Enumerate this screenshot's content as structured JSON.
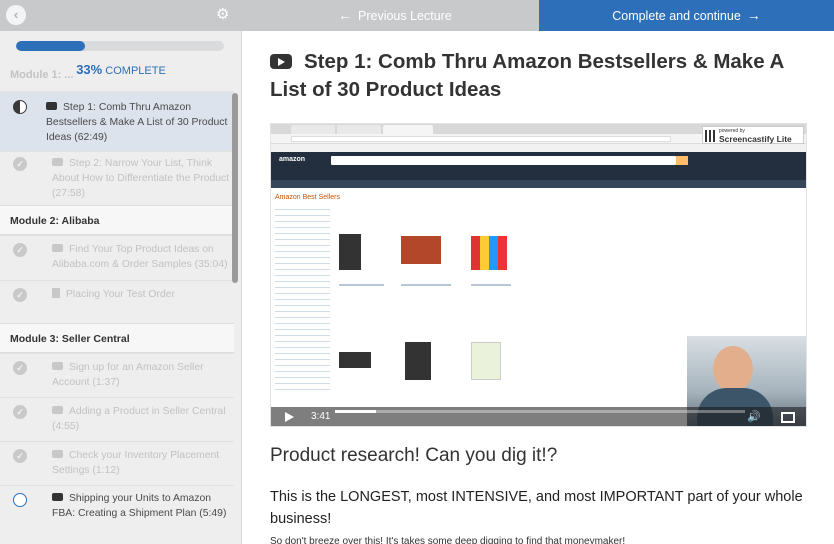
{
  "topbar": {
    "prev_label": "Previous Lecture",
    "complete_label": "Complete and continue",
    "prev_arrow": "←",
    "complete_arrow": "→",
    "back_icon": "‹",
    "gear_icon": "⚙"
  },
  "progress": {
    "percent": 33,
    "percent_label": "33%",
    "label": "COMPLETE",
    "fill_color": "#2d6fb8"
  },
  "sidebar": {
    "ghost_module": "Module 1: ...",
    "modules": [
      {
        "title": "Module 2: Alibaba"
      },
      {
        "title": "Module 3: Seller Central"
      }
    ],
    "items": [
      {
        "label": "Step 1: Comb Thru Amazon Bestsellers & Make A List of 30 Product Ideas (62:49)",
        "status": "half",
        "type": "video"
      },
      {
        "label": "Step 2: Narrow Your List, Think About How to Differentiate the Product (27:58)",
        "status": "done",
        "type": "video"
      },
      {
        "label": "Find Your Top Product Ideas on Alibaba.com & Order Samples (35:04)",
        "status": "done",
        "type": "video"
      },
      {
        "label": "Placing Your Test Order",
        "status": "done",
        "type": "document"
      },
      {
        "label": "Sign up for an Amazon Seller Account (1:37)",
        "status": "done",
        "type": "video"
      },
      {
        "label": "Adding a Product in Seller Central (4:55)",
        "status": "done",
        "type": "video"
      },
      {
        "label": "Check your Inventory Placement Settings (1:12)",
        "status": "done",
        "type": "video"
      },
      {
        "label": "Shipping your Units to Amazon FBA: Creating a Shipment Plan (5:49)",
        "status": "empty",
        "type": "video"
      }
    ]
  },
  "main": {
    "title": "Step 1: Comb Thru Amazon Bestsellers & Make A List of 30 Product Ideas",
    "video": {
      "time": "3:41",
      "seek_fraction": 0.1,
      "badge_line1": "powered by",
      "badge_line2": "Screencastify Lite",
      "amazon_logo": "amazon",
      "bestsellers_title": "Amazon Best Sellers"
    },
    "heading2": "Product research! Can you dig it!?",
    "paragraph": "This is the LONGEST, most INTENSIVE, and most IMPORTANT part of your whole business!",
    "paragraph2": "So don't breeze over this! It's takes some deep digging to find that moneymaker!"
  },
  "colors": {
    "accent": "#2d6fb8",
    "topbar": "#c8c9cb",
    "sidebar_bg": "#eeeeef"
  }
}
